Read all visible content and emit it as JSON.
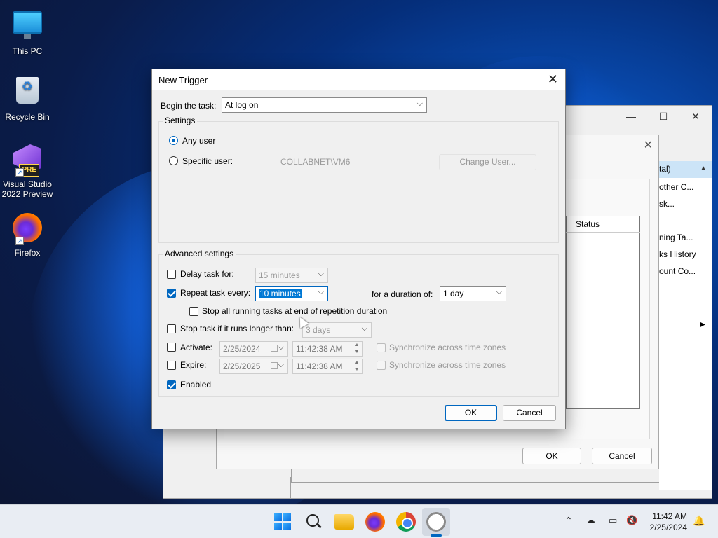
{
  "desktop": {
    "icons": [
      {
        "label": "This PC"
      },
      {
        "label": "Recycle Bin"
      },
      {
        "label": "Visual Studio 2022 Preview",
        "badge": "PRE"
      },
      {
        "label": "Firefox"
      }
    ]
  },
  "background_window": {
    "caption_buttons": [
      "—",
      "☐",
      "✕"
    ],
    "status_col": "Status",
    "side_items": [
      "tal)",
      "other C...",
      "sk...",
      "ning Ta...",
      "ks History",
      "ount Co..."
    ],
    "ok": "OK",
    "cancel": "Cancel"
  },
  "dialog": {
    "title": "New Trigger",
    "begin_label": "Begin the task:",
    "begin_value": "At log on",
    "settings_label": "Settings",
    "any_user": "Any user",
    "specific_user": "Specific user:",
    "user_name": "COLLABNET\\VM6",
    "change_user": "Change User...",
    "advanced_label": "Advanced settings",
    "delay_label": "Delay task for:",
    "delay_value": "15 minutes",
    "repeat_label": "Repeat task every:",
    "repeat_value": "10 minutes",
    "duration_label": "for a duration of:",
    "duration_value": "1 day",
    "stop_running_label": "Stop all running tasks at end of repetition duration",
    "stop_longer_label": "Stop task if it runs longer than:",
    "stop_longer_value": "3 days",
    "activate_label": "Activate:",
    "activate_date": "2/25/2024",
    "activate_time": "11:42:38 AM",
    "expire_label": "Expire:",
    "expire_date": "2/25/2025",
    "expire_time": "11:42:38 AM",
    "sync_label": "Synchronize across time zones",
    "enabled_label": "Enabled",
    "ok": "OK",
    "cancel": "Cancel",
    "close_glyph": "✕"
  },
  "taskbar": {
    "time": "11:42 AM",
    "date": "2/25/2024",
    "tray_up": "⌃",
    "bell": "🔔"
  },
  "colors": {
    "accent": "#0067c0",
    "selection": "#0078d4"
  }
}
